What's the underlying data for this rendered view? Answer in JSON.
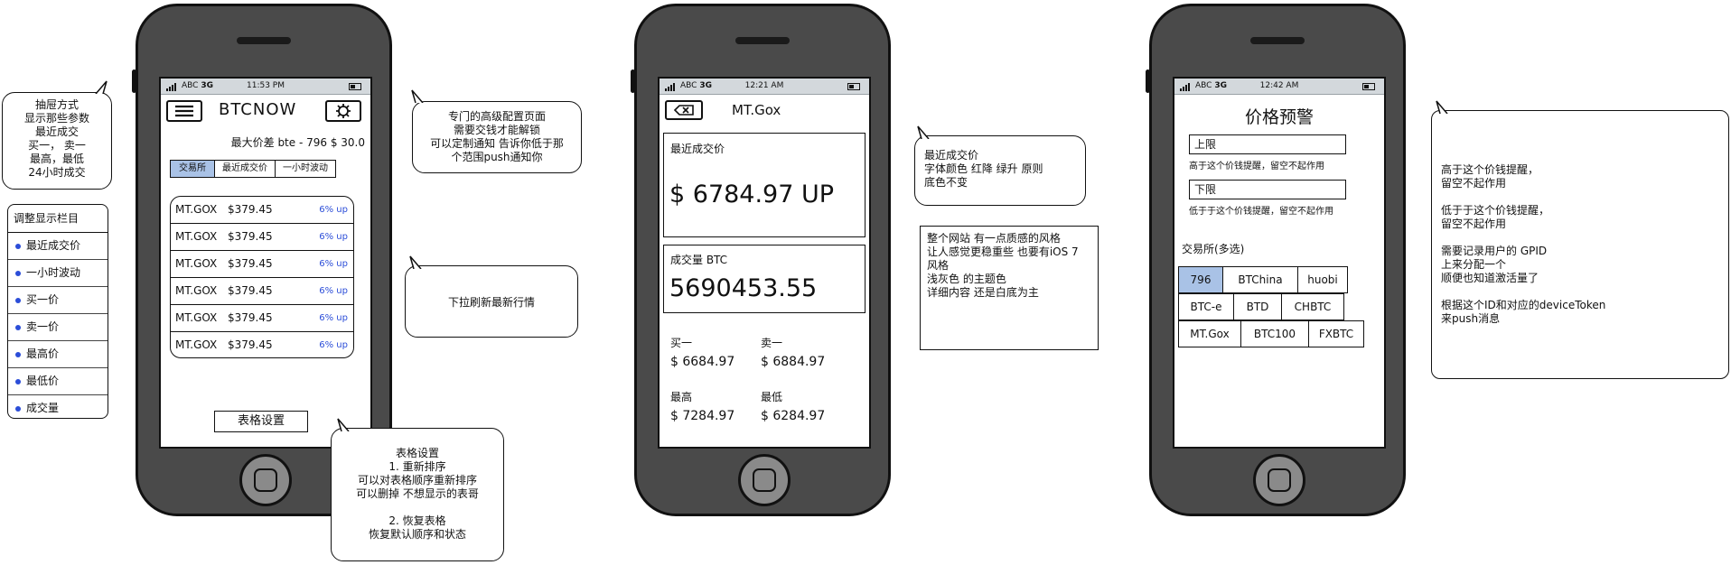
{
  "status": {
    "carrier": "ABC",
    "network": "3G",
    "times": [
      "11:53 PM",
      "12:21 AM",
      "12:42 AM"
    ]
  },
  "phone1": {
    "title": "BTCNOW",
    "max_spread": "最大价差 bte - 796 $ 30.0",
    "tabs": [
      "交易所",
      "最近成交价",
      "一小时波动"
    ],
    "rows": [
      {
        "name": "MT.GOX",
        "price": "$379.45",
        "change": "6% up"
      },
      {
        "name": "MT.GOX",
        "price": "$379.45",
        "change": "6% up"
      },
      {
        "name": "MT.GOX",
        "price": "$379.45",
        "change": "6% up"
      },
      {
        "name": "MT.GOX",
        "price": "$379.45",
        "change": "6% up"
      },
      {
        "name": "MT.GOX",
        "price": "$379.45",
        "change": "6% up"
      },
      {
        "name": "MT.GOX",
        "price": "$379.45",
        "change": "6% up"
      }
    ],
    "settings_button": "表格设置"
  },
  "phone2": {
    "title": "MT.Gox",
    "last_price_label": "最近成交价",
    "last_price_value": "$ 6784.97 UP",
    "volume_label": "成交量 BTC",
    "volume_value": "5690453.55",
    "buy_label": "买一",
    "buy_value": "$ 6684.97",
    "sell_label": "卖一",
    "sell_value": "$ 6884.97",
    "high_label": "最高",
    "high_value": "$ 7284.97",
    "low_label": "最低",
    "low_value": "$ 6284.97"
  },
  "phone3": {
    "title": "价格预警",
    "upper_label": "上限",
    "upper_hint": "高于这个价钱提醒，留空不起作用",
    "lower_label": "下限",
    "lower_hint": "低于于这个价钱提醒，留空不起作用",
    "exchange_label": "交易所(多选)",
    "exchanges": [
      "796",
      "BTChina",
      "huobi",
      "BTC-e",
      "BTD",
      "CHBTC",
      "MT.Gox",
      "BTC100",
      "FXBTC"
    ]
  },
  "notes": {
    "drawer": [
      "抽屉方式",
      "显示那些参数",
      "最近成交",
      "买一，  卖一",
      "最高，最低",
      "24小时成交"
    ],
    "columns_title": "调整显示栏目",
    "columns": [
      "最近成交价",
      "一小时波动",
      "买一价",
      "卖一价",
      "最高价",
      "最低价",
      "成交量"
    ],
    "advanced": [
      "专门的高级配置页面",
      "需要交钱才能解锁",
      "可以定制通知 告诉你低于那",
      "个范围push通知你"
    ],
    "pull_refresh": "下拉刷新最新行情",
    "table_settings": [
      "表格设置",
      "1. 重新排序",
      "可以对表格顺序重新排序",
      "可以删掉 不想显示的表哥",
      "",
      "2. 恢复表格",
      "恢复默认顺序和状态"
    ],
    "colors": [
      "最近成交价",
      "字体颜色 红降 绿升 原则",
      "底色不变"
    ],
    "style": [
      "整个网站 有一点质感的风格",
      "让人感觉更稳重些 也要有iOS 7",
      "风格",
      "浅灰色 的主题色",
      "详细内容 还是白底为主"
    ],
    "alerts": [
      "高于这个价钱提醒，",
      "留空不起作用",
      "",
      "低于于这个价钱提醒，",
      "留空不起作用",
      "",
      "需要记录用户的 GPID",
      "上来分配一个",
      "顺便也知道激活量了",
      "",
      "根据这个ID和对应的deviceToken",
      "来push消息"
    ]
  }
}
